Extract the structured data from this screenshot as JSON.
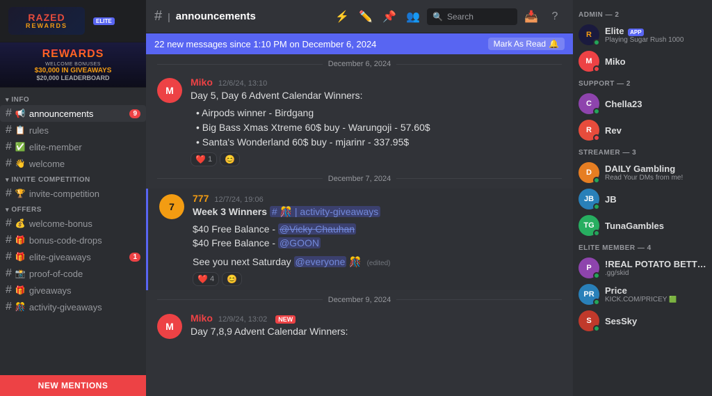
{
  "server": {
    "name": "Razed",
    "logo_line1": "RAZED",
    "logo_line2": "REWARDS",
    "elite_badge": "ELITE",
    "banner": {
      "title": "REWARDS",
      "subtitle1": "WELCOME BONUSES",
      "amount1": "$30,000 IN GIVEAWAYS",
      "amount2": "$20,000 LEADERBOARD"
    }
  },
  "sidebar": {
    "sections": [
      {
        "name": "INFO",
        "items": [
          {
            "id": "announcements",
            "label": "announcements",
            "icon": "#",
            "emoji": "📢",
            "badge": 9,
            "active": true
          },
          {
            "id": "rules",
            "label": "rules",
            "icon": "#",
            "emoji": "📋"
          },
          {
            "id": "elite-member",
            "label": "elite-member",
            "icon": "#",
            "emoji": "✅"
          },
          {
            "id": "welcome",
            "label": "welcome",
            "icon": "#",
            "emoji": "👋"
          }
        ]
      },
      {
        "name": "INVITE COMPETITION",
        "items": [
          {
            "id": "invite-competition",
            "label": "invite-competition",
            "icon": "#",
            "emoji": "🏆"
          }
        ]
      },
      {
        "name": "OFFERS",
        "items": [
          {
            "id": "welcome-bonus",
            "label": "welcome-bonus",
            "icon": "#",
            "emoji": "💰"
          },
          {
            "id": "bonus-code-drops",
            "label": "bonus-code-drops",
            "icon": "#",
            "emoji": "🎁"
          },
          {
            "id": "elite-giveaways",
            "label": "elite-giveaways",
            "icon": "#",
            "emoji": "🎁",
            "badge": 1
          },
          {
            "id": "proof-of-code",
            "label": "proof-of-code",
            "icon": "#",
            "emoji": "📸"
          },
          {
            "id": "giveaways",
            "label": "giveaways",
            "icon": "#",
            "emoji": "🎁"
          },
          {
            "id": "activity-giveaways",
            "label": "activity-giveaways",
            "icon": "#",
            "emoji": "🎊"
          }
        ]
      }
    ],
    "new_mentions_label": "NEW MENTIONS"
  },
  "header": {
    "channel_icon": "#",
    "channel_separator": "|",
    "channel_name": "announcements",
    "icons": {
      "hashtag": "#",
      "pin": "📌",
      "members": "👥",
      "search_placeholder": "Search",
      "inbox": "📥",
      "help": "?"
    }
  },
  "chat": {
    "new_messages_bar": {
      "text": "22 new messages since 1:10 PM on December 6, 2024",
      "mark_as_read": "Mark As Read"
    },
    "messages": [
      {
        "id": "msg1",
        "date_divider": "December 6, 2024",
        "author": "Miko",
        "avatar_initials": "M",
        "avatar_class": "avatar-miko",
        "timestamp": "12/6/24, 13:10",
        "username_color": "red",
        "text": "Day 5, Day 6 Advent Calendar Winners:",
        "bullets": [
          "Airpods winner - Birdgang",
          "Big Bass Xmas Xtreme 60$ buy - Warungoji  - 57.60$",
          "Santa's Wonderland 60$ buy - mjarinr - 337.95$"
        ],
        "reactions": [
          {
            "emoji": "❤️",
            "count": "1"
          },
          {
            "emoji": "😊",
            "count": ""
          }
        ]
      },
      {
        "id": "msg2",
        "date_divider": "December 7, 2024",
        "author": "777",
        "avatar_initials": "7",
        "avatar_class": "avatar-777",
        "timestamp": "12/7/24, 19:06",
        "username_color": "orange",
        "highlighted": true,
        "text_parts": {
          "prefix": "Week 3 Winners ",
          "channel_mention": "# 🎊 | activity-giveaways"
        },
        "body_lines": [
          "$40 Free Balance - @Vicky Chauhan",
          "$40 Free Balance - @GOON"
        ],
        "footer": "See you next Saturday @everyone 🎊 (edited)",
        "reactions": [
          {
            "emoji": "❤️",
            "count": "4"
          },
          {
            "emoji": "😊",
            "count": ""
          }
        ]
      },
      {
        "id": "msg3",
        "date_divider": "December 9, 2024",
        "author": "Miko",
        "avatar_initials": "M",
        "avatar_class": "avatar-miko",
        "timestamp": "12/9/24, 13:02",
        "username_color": "red",
        "text": "Day 7,8,9 Advent Calendar Winners:",
        "new_badge": true
      }
    ]
  },
  "members": {
    "sections": [
      {
        "role": "ADMIN",
        "count": 2,
        "label": "ADMIN — 2",
        "members": [
          {
            "name": "Elite",
            "badges": [
              "APP"
            ],
            "status_text": "Playing Sugar Rush 1000",
            "status": "online",
            "avatar_class": "av-elite",
            "initials": "R"
          },
          {
            "name": "Miko",
            "status_text": "",
            "status": "dnd",
            "avatar_class": "av-miko",
            "initials": "M"
          }
        ]
      },
      {
        "role": "SUPPORT",
        "count": 2,
        "label": "SUPPORT — 2",
        "members": [
          {
            "name": "Chella23",
            "status_text": "",
            "status": "online",
            "avatar_class": "av-chella",
            "initials": "C"
          },
          {
            "name": "Rev",
            "status_text": "",
            "status": "dnd",
            "avatar_class": "av-rev",
            "initials": "R"
          }
        ]
      },
      {
        "role": "STREAMER",
        "count": 3,
        "label": "STREAMER — 3",
        "members": [
          {
            "name": "DAILY Gambling",
            "status_text": "Read Your DMs from me!",
            "status": "online",
            "avatar_class": "av-daily",
            "initials": "D"
          },
          {
            "name": "JB",
            "status_text": "",
            "status": "online",
            "avatar_class": "av-jb",
            "initials": "JB"
          },
          {
            "name": "TunaGambles",
            "status_text": "",
            "status": "online",
            "avatar_class": "av-tuna",
            "initials": "TG"
          }
        ]
      },
      {
        "role": "ELITE MEMBER",
        "count": 4,
        "label": "ELITE MEMBER — 4",
        "members": [
          {
            "name": "!REAL POTATO BETTER",
            "status_text": ".gg/skid",
            "status": "online",
            "avatar_class": "av-potato",
            "initials": "P"
          },
          {
            "name": "Price",
            "status_text": "KICK.COM/PRICEY",
            "status": "online",
            "avatar_class": "av-price",
            "initials": "PR",
            "kick_badge": true
          },
          {
            "name": "SesSky",
            "status_text": "",
            "status": "online",
            "avatar_class": "av-sesky",
            "initials": "S"
          }
        ]
      }
    ]
  }
}
